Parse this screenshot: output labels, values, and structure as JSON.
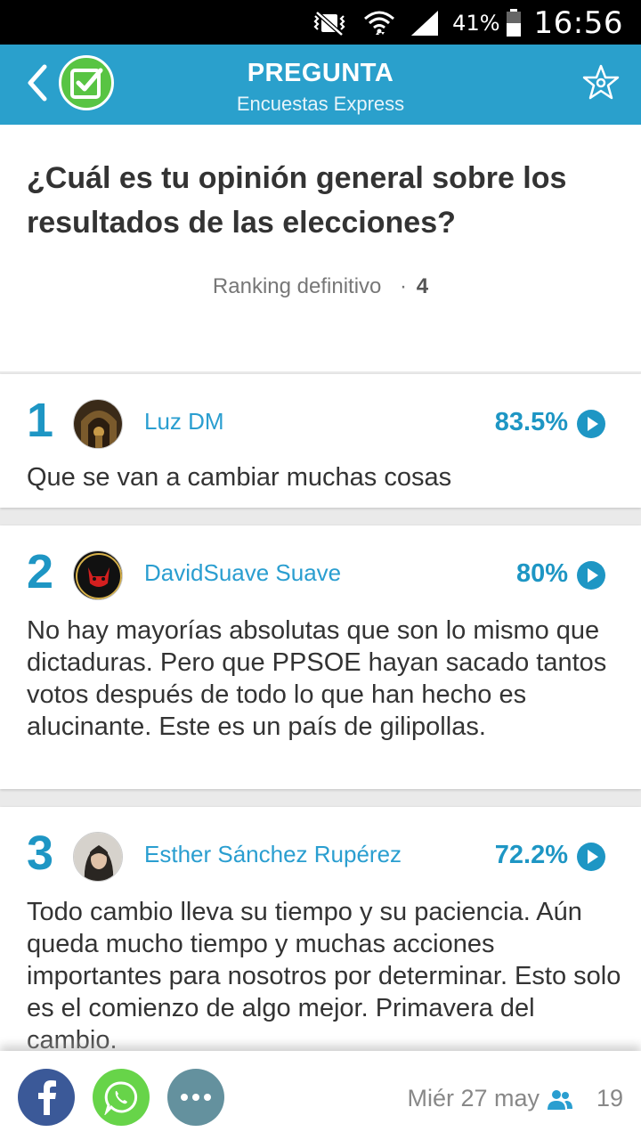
{
  "status_bar": {
    "battery_percent": "41%",
    "time": "16:56",
    "icons": [
      "mute-vibrate-icon",
      "wifi-icon",
      "signal-icon",
      "battery-icon"
    ]
  },
  "header": {
    "title": "PREGUNTA",
    "subtitle": "Encuestas Express",
    "accent_color": "#2aa0cc",
    "icons": [
      "back-chevron-icon",
      "app-check-logo",
      "favorite-star-icon"
    ]
  },
  "question": {
    "text": "¿Cuál es tu opinión general sobre los resultados de las elecciones?",
    "ranking_label": "Ranking definitivo",
    "ranking_separator": "·",
    "ranking_count": "4"
  },
  "answers": [
    {
      "rank": "1",
      "author": "Luz DM",
      "percent": "83.5%",
      "text": "Que se van a cambiar muchas cosas"
    },
    {
      "rank": "2",
      "author": "DavidSuave Suave",
      "percent": "80%",
      "text": "No hay mayorías absolutas que son lo mismo que dictaduras. Pero que PPSOE hayan sacado tantos votos después de todo lo que han hecho es alucinante. Este es un país de gilipollas."
    },
    {
      "rank": "3",
      "author": "Esther Sánchez Rupérez",
      "percent": "72.2%",
      "text": "Todo cambio lleva su tiempo y su paciencia. Aún queda mucho tiempo y muchas acciones importantes para nosotros por determinar. Esto solo es el comienzo de algo mejor. Primavera del cambio."
    }
  ],
  "footer": {
    "date": "Miér 27 may",
    "participants": "19",
    "share_buttons": [
      "facebook-icon",
      "whatsapp-icon",
      "more-options-icon"
    ]
  }
}
